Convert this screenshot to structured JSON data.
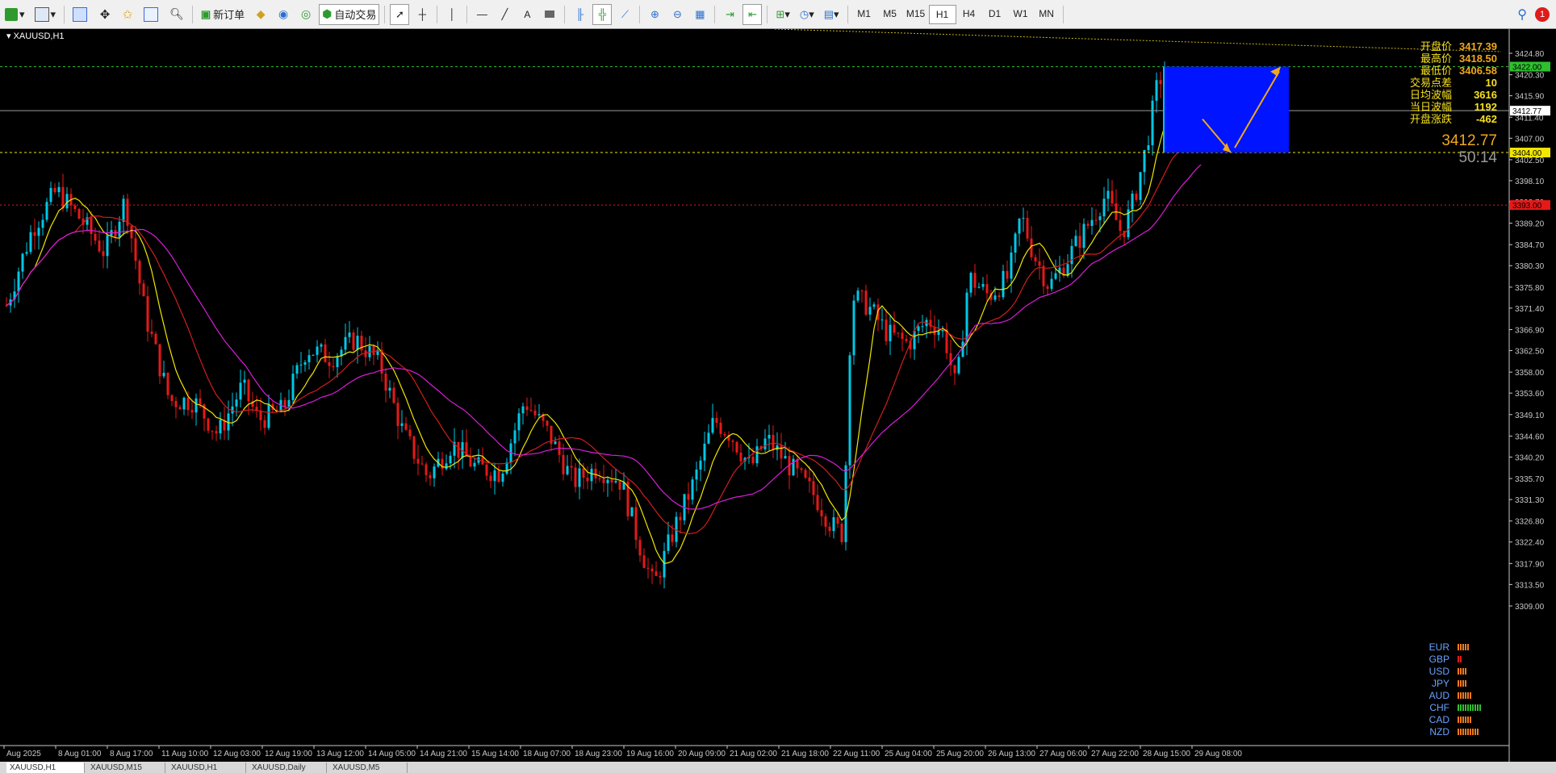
{
  "toolbar": {
    "new_order": "新订单",
    "auto_trade": "自动交易",
    "timeframes": [
      "M1",
      "M5",
      "M15",
      "H1",
      "H4",
      "D1",
      "W1",
      "MN"
    ],
    "active_timeframe": "H1",
    "notification_count": "1"
  },
  "chart": {
    "title": "XAUUSD,H1",
    "price_axis": [
      "3424.80",
      "3420.30",
      "3415.90",
      "3411.40",
      "3407.00",
      "3402.50",
      "3398.10",
      "3393.70",
      "3389.20",
      "3384.70",
      "3380.30",
      "3375.80",
      "3371.40",
      "3366.90",
      "3362.50",
      "3358.00",
      "3353.60",
      "3349.10",
      "3344.60",
      "3340.20",
      "3335.70",
      "3331.30",
      "3326.80",
      "3322.40",
      "3317.90",
      "3313.50",
      "3309.00"
    ],
    "time_axis": [
      "Aug 2025",
      "8 Aug 01:00",
      "8 Aug 17:00",
      "11 Aug 10:00",
      "12 Aug 03:00",
      "12 Aug 19:00",
      "13 Aug 12:00",
      "14 Aug 05:00",
      "14 Aug 21:00",
      "15 Aug 14:00",
      "18 Aug 07:00",
      "18 Aug 23:00",
      "19 Aug 16:00",
      "20 Aug 09:00",
      "21 Aug 02:00",
      "21 Aug 18:00",
      "22 Aug 11:00",
      "25 Aug 04:00",
      "25 Aug 20:00",
      "26 Aug 13:00",
      "27 Aug 06:00",
      "27 Aug 22:00",
      "28 Aug 15:00",
      "29 Aug 08:00"
    ],
    "level_labels": {
      "green": "3422.00",
      "current": "3412.77",
      "yellow": "3404.00",
      "red": "3393.00"
    },
    "colors": {
      "bull": "#00c8e6",
      "bear": "#e61919",
      "ma_fast": "#f0e600",
      "ma_mid": "#d01e1e",
      "ma_slow": "#d61ed6",
      "box": "#0014ff",
      "arrow": "#f0a81b"
    }
  },
  "info_panel": [
    {
      "k": "开盘价",
      "v": "3417.39"
    },
    {
      "k": "最高价",
      "v": "3418.50"
    },
    {
      "k": "最低价",
      "v": "3406.58"
    },
    {
      "k": "交易点差",
      "v": "10"
    },
    {
      "k": "日均波幅",
      "v": "3616"
    },
    {
      "k": "当日波幅",
      "v": "1192"
    },
    {
      "k": "开盘涨跌",
      "v": "-462"
    }
  ],
  "price_big": "3412.77",
  "timer": "50:14",
  "currency_strength": [
    {
      "name": "EUR",
      "bars": 5,
      "color": "#f07a1b"
    },
    {
      "name": "GBP",
      "bars": 2,
      "color": "#e61919"
    },
    {
      "name": "USD",
      "bars": 4,
      "color": "#f07a1b"
    },
    {
      "name": "JPY",
      "bars": 4,
      "color": "#f07a1b"
    },
    {
      "name": "AUD",
      "bars": 6,
      "color": "#f07a1b"
    },
    {
      "name": "CHF",
      "bars": 10,
      "color": "#2ec02e"
    },
    {
      "name": "CAD",
      "bars": 6,
      "color": "#f07a1b"
    },
    {
      "name": "NZD",
      "bars": 9,
      "color": "#f07a1b"
    }
  ],
  "tabs": [
    "XAUUSD,H1",
    "XAUUSD,M15",
    "XAUUSD,H1",
    "XAUUSD,Daily",
    "XAUUSD,M5"
  ]
}
